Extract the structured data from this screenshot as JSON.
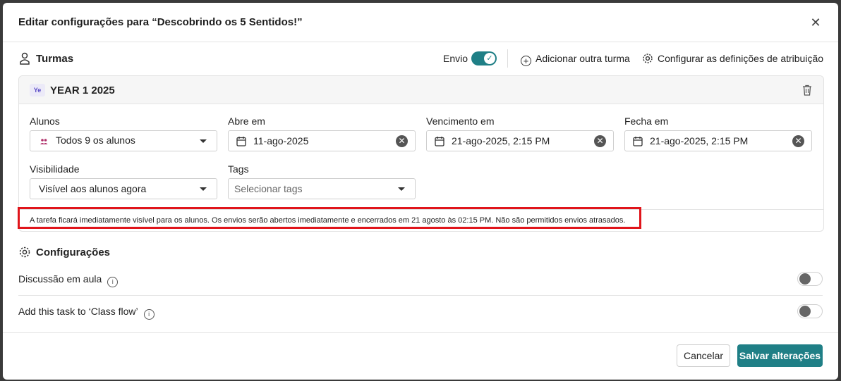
{
  "modal": {
    "title": "Editar configurações para “Descobrindo os 5 Sentidos!”",
    "close_icon": "close-icon"
  },
  "turmas": {
    "title": "Turmas",
    "envio_label": "Envio",
    "envio_enabled": true,
    "add_class_label": "Adicionar outra turma",
    "config_assign_label": "Configurar as definições de atribuição"
  },
  "class_card": {
    "avatar": "Ye",
    "name": "YEAR 1 2025",
    "fields": {
      "alunos_label": "Alunos",
      "alunos_value": "Todos 9 os alunos",
      "abre_label": "Abre em",
      "abre_value": "11-ago-2025",
      "vencimento_label": "Vencimento em",
      "vencimento_value": "21-ago-2025, 2:15 PM",
      "fecha_label": "Fecha em",
      "fecha_value": "21-ago-2025, 2:15 PM",
      "visibilidade_label": "Visibilidade",
      "visibilidade_value": "Visível aos alunos agora",
      "tags_label": "Tags",
      "tags_placeholder": "Selecionar tags"
    },
    "info_text": "A tarefa ficará imediatamente visível para os alunos. Os envios serão abertos imediatamente e encerrados em 21 agosto às 02:15 PM. Não são permitidos envios atrasados."
  },
  "configuracoes": {
    "title": "Configurações",
    "settings": [
      {
        "label": "Discussão em aula",
        "enabled": false
      },
      {
        "label": "Add this task to ‘Class flow’",
        "enabled": false
      }
    ]
  },
  "footer": {
    "cancel_label": "Cancelar",
    "save_label": "Salvar alterações"
  },
  "colors": {
    "accent": "#1f7f86",
    "highlight": "#e0151b"
  }
}
